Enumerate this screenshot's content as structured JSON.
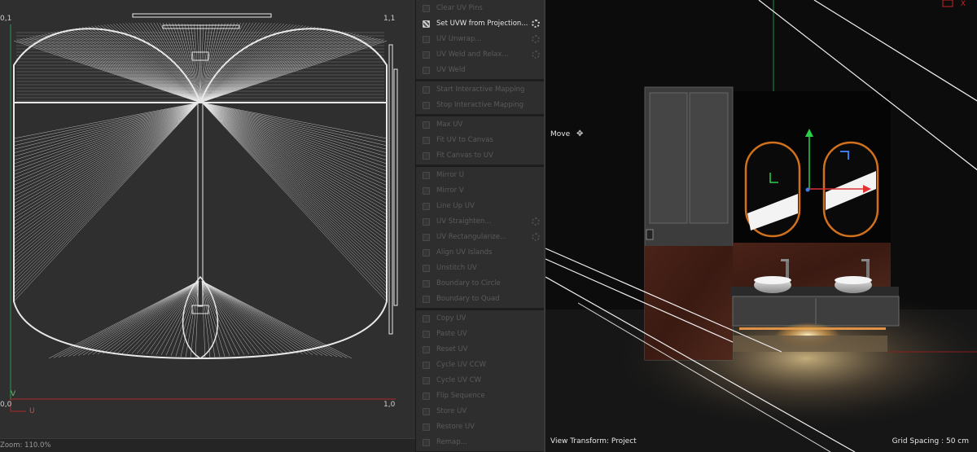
{
  "uv_editor": {
    "corner_top_left": "0,1",
    "corner_top_right": "1,1",
    "corner_bottom_left": "0,0",
    "corner_bottom_right": "1,0",
    "axis_v": "V",
    "axis_u": "U",
    "status": "Zoom: 110.0%"
  },
  "commands": {
    "groups": [
      {
        "items": [
          {
            "label": "Clear UV Pins",
            "active": false,
            "gear": false
          },
          {
            "label": "Set UVW from Projection...",
            "active": true,
            "gear": true
          },
          {
            "label": "UV Unwrap...",
            "active": false,
            "gear": true
          },
          {
            "label": "UV Weld and Relax...",
            "active": false,
            "gear": true
          },
          {
            "label": "UV Weld",
            "active": false,
            "gear": false
          }
        ]
      },
      {
        "items": [
          {
            "label": "Start Interactive Mapping",
            "active": false,
            "gear": false
          },
          {
            "label": "Stop Interactive Mapping",
            "active": false,
            "gear": false
          }
        ]
      },
      {
        "items": [
          {
            "label": "Max UV",
            "active": false,
            "gear": false
          },
          {
            "label": "Fit UV to Canvas",
            "active": false,
            "gear": false
          },
          {
            "label": "Fit Canvas to UV",
            "active": false,
            "gear": false
          }
        ]
      },
      {
        "items": [
          {
            "label": "Mirror U",
            "active": false,
            "gear": false
          },
          {
            "label": "Mirror V",
            "active": false,
            "gear": false
          },
          {
            "label": "Line Up UV",
            "active": false,
            "gear": false
          },
          {
            "label": "UV Straighten...",
            "active": false,
            "gear": true
          },
          {
            "label": "UV Rectangularize...",
            "active": false,
            "gear": true
          },
          {
            "label": "Align UV Islands",
            "active": false,
            "gear": false
          },
          {
            "label": "Unstitch UV",
            "active": false,
            "gear": false
          },
          {
            "label": "Boundary to Circle",
            "active": false,
            "gear": false
          },
          {
            "label": "Boundary to Quad",
            "active": false,
            "gear": false
          }
        ]
      },
      {
        "items": [
          {
            "label": "Copy UV",
            "active": false,
            "gear": false
          },
          {
            "label": "Paste UV",
            "active": false,
            "gear": false
          },
          {
            "label": "Reset UV",
            "active": false,
            "gear": false
          },
          {
            "label": "Cycle UV CCW",
            "active": false,
            "gear": false
          },
          {
            "label": "Cycle UV CW",
            "active": false,
            "gear": false
          },
          {
            "label": "Flip Sequence",
            "active": false,
            "gear": false
          },
          {
            "label": "Store UV",
            "active": false,
            "gear": false
          },
          {
            "label": "Restore UV",
            "active": false,
            "gear": false
          },
          {
            "label": "Remap...",
            "active": false,
            "gear": false
          }
        ]
      }
    ]
  },
  "viewport": {
    "tool_label": "Move",
    "move_icon": "move-cross-icon",
    "view_transform": "View Transform: Project",
    "grid_spacing": "Grid Spacing : 50 cm",
    "axis_x": "X"
  },
  "colors": {
    "uv_lines": "#e8e8e8",
    "uv_background": "#2f2f2f",
    "axis_red": "#b02a2a",
    "axis_green": "#2a9a4a",
    "mirror_frame": "#d2701c",
    "viewport_bg": "#0c0c0c"
  }
}
